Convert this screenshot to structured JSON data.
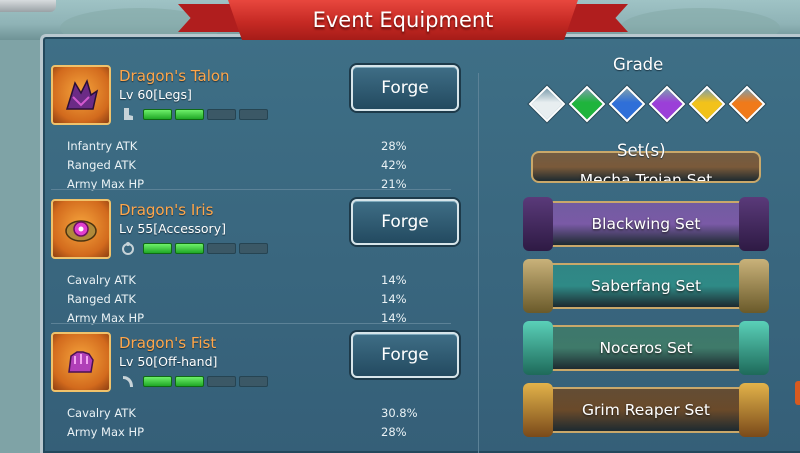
{
  "title": "Event Equipment",
  "items": [
    {
      "name": "Dragon's Talon",
      "level": "Lv 60[Legs]",
      "icon": "talon-icon",
      "slot_icon": "boot-icon",
      "progress": 0.4,
      "forge_label": "Forge",
      "stats": [
        {
          "name": "Infantry ATK",
          "value": "28%"
        },
        {
          "name": "Ranged ATK",
          "value": "42%"
        },
        {
          "name": "Army Max HP",
          "value": "21%"
        }
      ]
    },
    {
      "name": "Dragon's Iris",
      "level": "Lv 55[Accessory]",
      "icon": "iris-icon",
      "slot_icon": "ring-icon",
      "progress": 0.4,
      "forge_label": "Forge",
      "stats": [
        {
          "name": "Cavalry ATK",
          "value": "14%"
        },
        {
          "name": "Ranged ATK",
          "value": "14%"
        },
        {
          "name": "Army Max HP",
          "value": "14%"
        }
      ]
    },
    {
      "name": "Dragon's Fist",
      "level": "Lv 50[Off-hand]",
      "icon": "fist-icon",
      "slot_icon": "off-hand-icon",
      "progress": 0.4,
      "forge_label": "Forge",
      "stats": [
        {
          "name": "Cavalry ATK",
          "value": "30.8%"
        },
        {
          "name": "Army Max HP",
          "value": "28%"
        }
      ]
    }
  ],
  "grade": {
    "label": "Grade",
    "gems": [
      {
        "name": "white",
        "color": "#e8eef0"
      },
      {
        "name": "green",
        "color": "#1fb43c"
      },
      {
        "name": "blue",
        "color": "#2f6fd8"
      },
      {
        "name": "purple",
        "color": "#9b3fd8"
      },
      {
        "name": "gold",
        "color": "#f2c21a"
      },
      {
        "name": "orange",
        "color": "#f07a1a"
      }
    ]
  },
  "sets": {
    "label": "Set(s)",
    "items": [
      {
        "name": "Mecha Trojan Set",
        "color": "#7a5a3a"
      },
      {
        "name": "Blackwing Set",
        "color": "#7a5aa6"
      },
      {
        "name": "Saberfang Set",
        "color": "#2f8a86"
      },
      {
        "name": "Noceros Set",
        "color": "#3f7a6a"
      },
      {
        "name": "Grim Reaper Set",
        "color": "#6a4a2a"
      }
    ]
  }
}
